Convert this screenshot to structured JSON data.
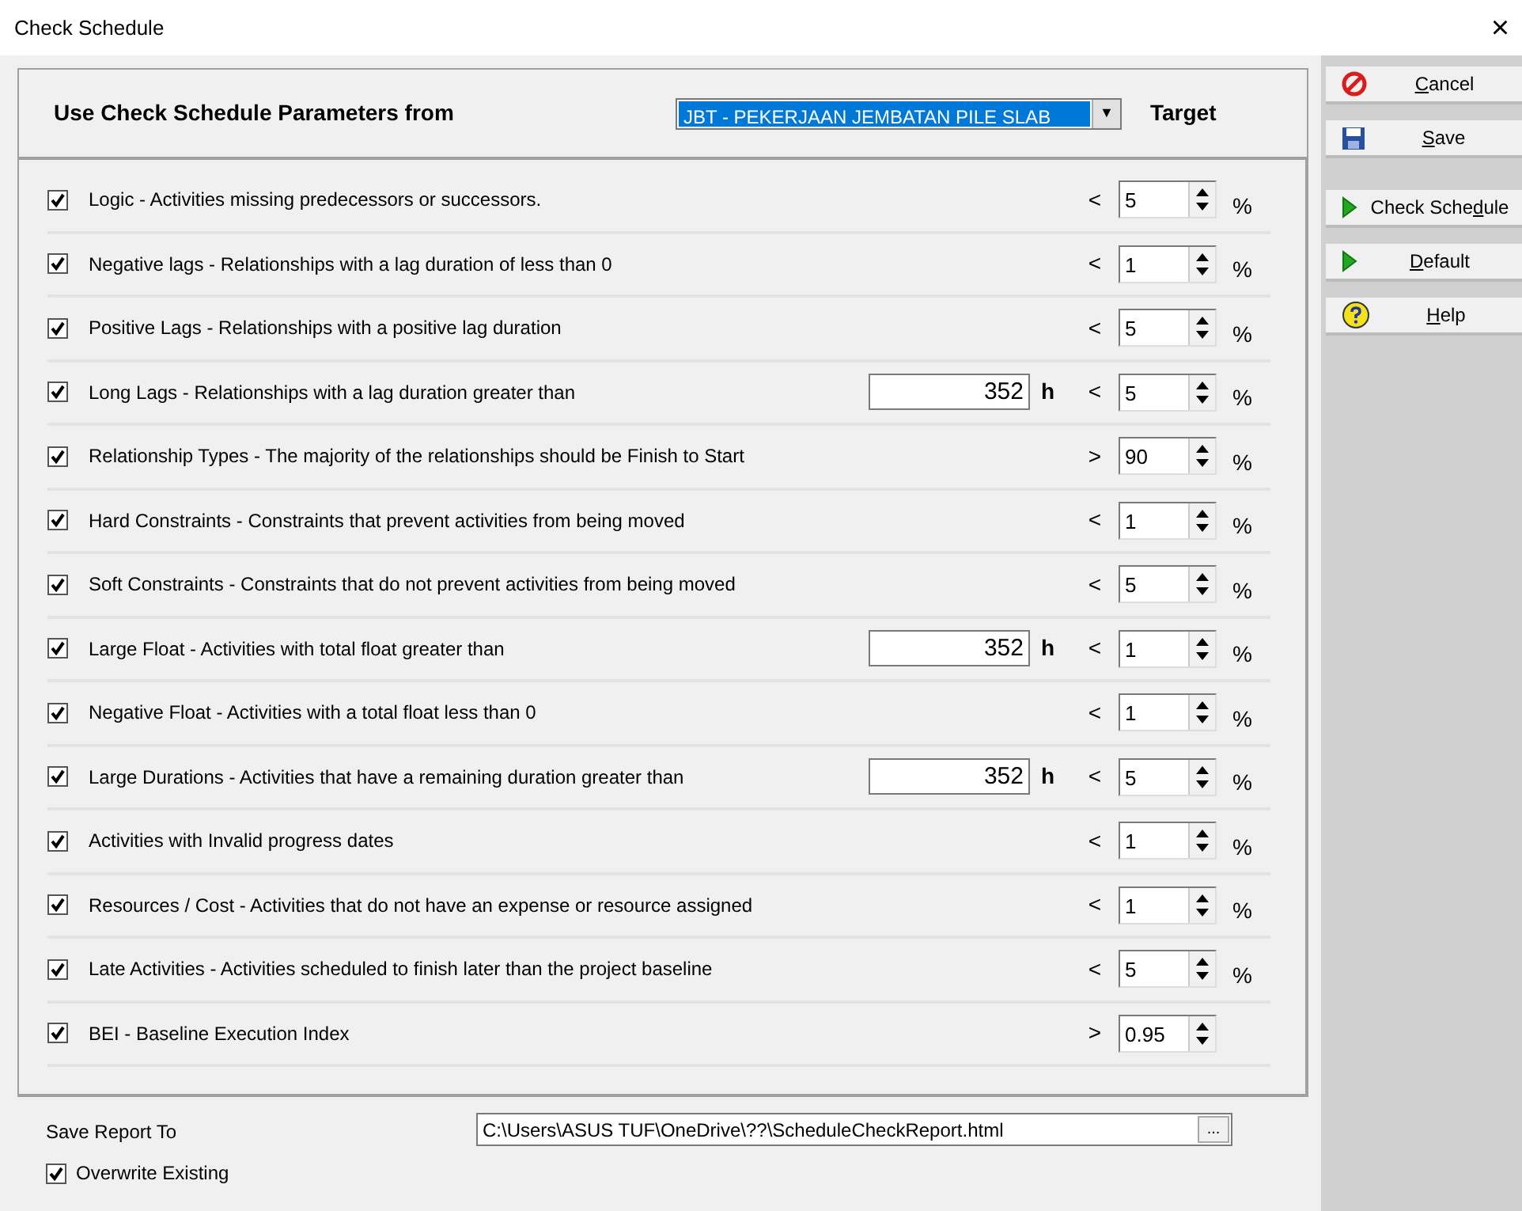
{
  "window": {
    "title": "Check Schedule",
    "close": "×"
  },
  "header": {
    "label": "Use Check Schedule Parameters from",
    "dropdown_value": "JBT - PEKERJAAN JEMBATAN PILE SLAB",
    "dropdown_arrow": "▼",
    "target_heading": "Target"
  },
  "checks": [
    {
      "checked": true,
      "label": "Logic - Activities missing predecessors or successors.",
      "operator": "<",
      "target": "5",
      "unit": "%"
    },
    {
      "checked": true,
      "label": "Negative lags - Relationships with a lag duration of less than 0",
      "operator": "<",
      "target": "1",
      "unit": "%"
    },
    {
      "checked": true,
      "label": "Positive Lags - Relationships with a positive lag duration",
      "operator": "<",
      "target": "5",
      "unit": "%"
    },
    {
      "checked": true,
      "label": "Long Lags - Relationships with a lag duration greater than",
      "threshold": "352",
      "threshold_unit": "h",
      "operator": "<",
      "target": "5",
      "unit": "%"
    },
    {
      "checked": true,
      "label": "Relationship Types - The majority of the relationships should be Finish to Start",
      "operator": ">",
      "target": "90",
      "unit": "%"
    },
    {
      "checked": true,
      "label": "Hard Constraints - Constraints that prevent activities from being moved",
      "operator": "<",
      "target": "1",
      "unit": "%"
    },
    {
      "checked": true,
      "label": "Soft Constraints - Constraints that do not prevent activities from being moved",
      "operator": "<",
      "target": "5",
      "unit": "%"
    },
    {
      "checked": true,
      "label": "Large Float - Activities with total float greater than",
      "threshold": "352",
      "threshold_unit": "h",
      "operator": "<",
      "target": "1",
      "unit": "%"
    },
    {
      "checked": true,
      "label": "Negative Float - Activities with a total float less than 0",
      "operator": "<",
      "target": "1",
      "unit": "%"
    },
    {
      "checked": true,
      "label": "Large Durations - Activities that have a remaining duration greater than",
      "threshold": "352",
      "threshold_unit": "h",
      "operator": "<",
      "target": "5",
      "unit": "%"
    },
    {
      "checked": true,
      "label": "Activities with Invalid progress dates",
      "operator": "<",
      "target": "1",
      "unit": "%"
    },
    {
      "checked": true,
      "label": "Resources / Cost - Activities that do not have an expense or resource assigned",
      "operator": "<",
      "target": "1",
      "unit": "%"
    },
    {
      "checked": true,
      "label": "Late Activities - Activities scheduled to finish later than the project baseline",
      "operator": "<",
      "target": "5",
      "unit": "%"
    },
    {
      "checked": true,
      "label": "BEI - Baseline Execution Index",
      "operator": ">",
      "target": "0.95"
    }
  ],
  "report": {
    "label": "Save Report To",
    "path": "C:\\Users\\ASUS TUF\\OneDrive\\??\\ScheduleCheckReport.html",
    "browse": "...",
    "overwrite_label": "Overwrite Existing",
    "overwrite_checked": true
  },
  "buttons": [
    {
      "kind": "cancel",
      "access_key": "C",
      "label_rest": "ancel"
    },
    {
      "kind": "save",
      "access_key": "S",
      "label_rest": "ave"
    },
    {
      "kind": "run",
      "label_start": "Check Sche",
      "access_key": "d",
      "label_rest": "ule"
    },
    {
      "kind": "run",
      "access_key": "D",
      "label_rest": "efault"
    },
    {
      "kind": "help",
      "access_key": "H",
      "label_rest": "elp"
    }
  ]
}
